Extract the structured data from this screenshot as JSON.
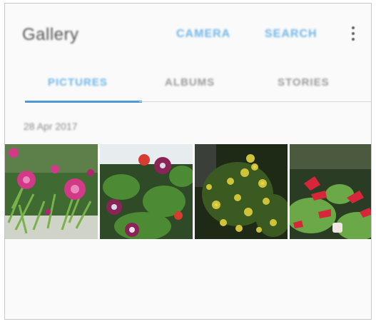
{
  "app": {
    "title": "Gallery"
  },
  "toolbar": {
    "camera_label": "CAMERA",
    "search_label": "SEARCH",
    "more_icon": "more-vertical-icon"
  },
  "tabs": [
    {
      "label": "PICTURES",
      "selected": true
    },
    {
      "label": "ALBUMS",
      "selected": false
    },
    {
      "label": "STORIES",
      "selected": false
    }
  ],
  "section": {
    "date": "28 Apr 2017"
  },
  "thumbnails": [
    {
      "subject": "pink flowers"
    },
    {
      "subject": "purple and red flowers"
    },
    {
      "subject": "yellow flowers"
    },
    {
      "subject": "red flowers"
    }
  ],
  "colors": {
    "accent": "#4a9ad6",
    "accent_text": "#6fb6e6"
  }
}
